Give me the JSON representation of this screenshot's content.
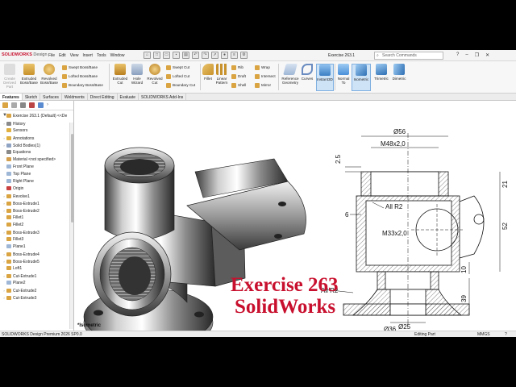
{
  "titlebar": {
    "logo_brand": "SOLIDWORKS",
    "logo_suffix": "Design",
    "menus": [
      "File",
      "Edit",
      "View",
      "Insert",
      "Tools",
      "Window"
    ],
    "document_title": "Exercise 263.1",
    "search_placeholder": "Search Commands"
  },
  "ribbon": {
    "create_derived_part": "Create Derived Part",
    "extruded_boss": "Extruded Boss/Base",
    "revolved_boss": "Revolved Boss/Base",
    "swept_boss": "Swept Boss/Base",
    "lofted_boss": "Lofted Boss/Base",
    "boundary_boss": "Boundary Boss/Base",
    "extruded_cut": "Extruded Cut",
    "hole_wizard": "Hole Wizard",
    "revolved_cut": "Revolved Cut",
    "swept_cut": "Swept Cut",
    "lofted_cut": "Lofted Cut",
    "boundary_cut": "Boundary Cut",
    "fillet": "Fillet",
    "linear_pattern": "Linear Pattern",
    "rib": "Rib",
    "draft": "Draft",
    "shell": "Shell",
    "wrap": "Wrap",
    "intersect": "Intersect",
    "mirror": "Mirror",
    "reference_geometry": "Reference Geometry",
    "curves": "Curves",
    "instant3d": "Instant3D",
    "normal_to": "Normal To",
    "isometric": "Isometric",
    "trimetric": "Trimetric",
    "dimetric": "Dimetric"
  },
  "tabs": [
    "Features",
    "Sketch",
    "Surfaces",
    "Weldments",
    "Direct Editing",
    "Evaluate",
    "SOLIDWORKS Add-Ins"
  ],
  "active_tab": "Features",
  "tree": {
    "root": "Exercise 263.1 (Default) <<De",
    "items": [
      {
        "label": "History",
        "icon": "history-icon",
        "color": "#8a8a8a",
        "exp": true
      },
      {
        "label": "Sensors",
        "icon": "sensor-icon",
        "color": "#e0b040",
        "exp": false
      },
      {
        "label": "Annotations",
        "icon": "annotation-icon",
        "color": "#e0b040",
        "exp": true
      },
      {
        "label": "Solid Bodies(1)",
        "icon": "solid-bodies-icon",
        "color": "#8fa3c2",
        "exp": true
      },
      {
        "label": "Equations",
        "icon": "equations-icon",
        "color": "#8a8a8a",
        "exp": false
      },
      {
        "label": "Material <not specified>",
        "icon": "material-icon",
        "color": "#d4a050",
        "exp": false
      },
      {
        "label": "Front Plane",
        "icon": "plane-icon",
        "color": "#9fb7d6",
        "exp": false
      },
      {
        "label": "Top Plane",
        "icon": "plane-icon",
        "color": "#9fb7d6",
        "exp": false
      },
      {
        "label": "Right Plane",
        "icon": "plane-icon",
        "color": "#9fb7d6",
        "exp": false
      },
      {
        "label": "Origin",
        "icon": "origin-icon",
        "color": "#c94040",
        "exp": false
      },
      {
        "label": "Revolve1",
        "icon": "revolve-icon",
        "color": "#d9a441",
        "exp": true
      },
      {
        "label": "Boss-Extrude1",
        "icon": "extrude-icon",
        "color": "#d9a441",
        "exp": true
      },
      {
        "label": "Boss-Extrude2",
        "icon": "extrude-icon",
        "color": "#d9a441",
        "exp": true
      },
      {
        "label": "Fillet1",
        "icon": "fillet-icon",
        "color": "#d9a441",
        "exp": false
      },
      {
        "label": "Fillet2",
        "icon": "fillet-icon",
        "color": "#d9a441",
        "exp": false
      },
      {
        "label": "Boss-Extrude3",
        "icon": "extrude-icon",
        "color": "#d9a441",
        "exp": true
      },
      {
        "label": "Fillet3",
        "icon": "fillet-icon",
        "color": "#d9a441",
        "exp": false
      },
      {
        "label": "Plane1",
        "icon": "plane-icon",
        "color": "#9fb7d6",
        "exp": false
      },
      {
        "label": "Boss-Extrude4",
        "icon": "extrude-icon",
        "color": "#d9a441",
        "exp": true
      },
      {
        "label": "Boss-Extrude5",
        "icon": "extrude-icon",
        "color": "#d9a441",
        "exp": true
      },
      {
        "label": "Loft1",
        "icon": "loft-icon",
        "color": "#d9a441",
        "exp": false
      },
      {
        "label": "Cut-Extrude1",
        "icon": "cut-icon",
        "color": "#d9a441",
        "exp": true
      },
      {
        "label": "Plane2",
        "icon": "plane-icon",
        "color": "#9fb7d6",
        "exp": false
      },
      {
        "label": "Cut-Extrude2",
        "icon": "cut-icon",
        "color": "#d9a441",
        "exp": true
      },
      {
        "label": "Cut-Extrude3",
        "icon": "cut-icon",
        "color": "#d9a441",
        "exp": true
      }
    ]
  },
  "view_label": "*Isometric",
  "drawing": {
    "dim_top_dia": "Ø56",
    "dim_thread_top": "M48x2,0",
    "dim_2_5": "2.5",
    "dim_21": "21",
    "dim_52": "52",
    "dim_6": "6",
    "dim_all_r2_a": "All R2",
    "dim_thread_mid": "M33x2,0",
    "dim_10": "10",
    "dim_all_r2_b": "All R2",
    "dim_39": "39",
    "dim_dia_25": "Ø25",
    "dim_dia_36": "Ø36"
  },
  "caption": {
    "line1": "Exercise 263",
    "line2": "SolidWorks"
  },
  "status": {
    "product": "SOLIDWORKS Design Premium 2026 SP0.0",
    "mode": "Editing Part",
    "units": "MMGS"
  },
  "colors": {
    "caption": "#c8102e",
    "brand": "#c8102e",
    "active_view": "#4a90d9"
  }
}
